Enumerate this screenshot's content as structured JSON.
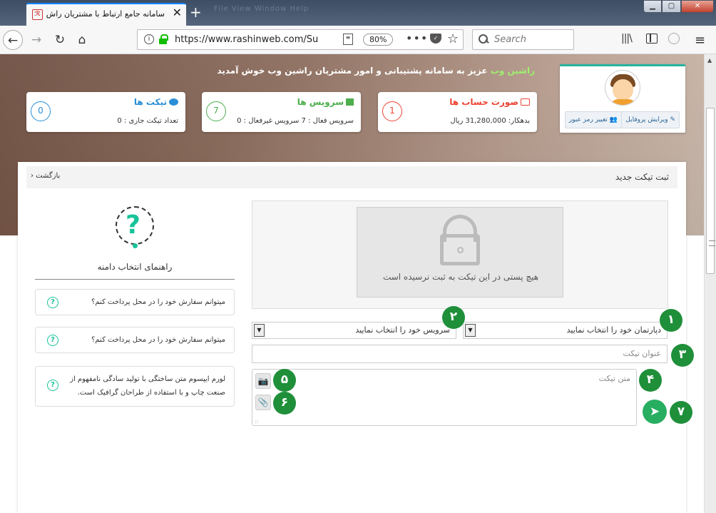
{
  "browser": {
    "tab_title": "سامانه جامع ارتباط با مشتریان راش",
    "tab_favicon": "ℛ",
    "new_tab": "+",
    "faint_menu": "File   View   Window   Help",
    "url": "https://www.rashinweb.com/Sup",
    "zoom": "80%",
    "search_placeholder": "Search",
    "icons": {
      "back": "back-arrow-icon",
      "forward": "forward-arrow-icon",
      "reload": "reload-icon",
      "home": "home-icon",
      "library": "library-icon",
      "sidebar": "sidebar-icon",
      "globe": "globe-icon",
      "menu": "hamburger-menu-icon"
    }
  },
  "hero": {
    "welcome_highlight": "راشین وب",
    "welcome_text": "عزیز به سامانه پشتیبانی و امور مشتریان راشین وب خوش آمدید",
    "profile": {
      "edit_profile": "ویرایش پروفایل",
      "change_password": "تغییر رمز عبور"
    },
    "cards": {
      "invoices": {
        "title": "صورت حساب ها",
        "count": "1",
        "info": "بدهکار: 31,280,000 ریال",
        "color": "#e44433"
      },
      "services": {
        "title": "سرویس ها",
        "count": "7",
        "info": "سرویس فعال : 7    سرویس غیرفعال : 0",
        "color": "#4cae4c"
      },
      "tickets": {
        "title": "تیکت ها",
        "count": "0",
        "info": "تعداد تیکت جاری : 0",
        "color": "#2a8fd6"
      }
    }
  },
  "page": {
    "title": "ثبت تیکت جدید",
    "back_link": "بازگشت ‹",
    "no_posts": "هیچ پستی در این تیکت به ثبت نرسیده است",
    "department_select": "دپارتمان خود را انتخاب نمایید",
    "service_select": "سرویس خود را انتخاب نمایید",
    "subject_placeholder": "عنوان تیکت",
    "message_placeholder": "متن تیکت"
  },
  "help": {
    "title": "راهنمای انتخاب دامنه",
    "question_mark": "?",
    "faqs": [
      "میتوانم سفارش خود را در محل پرداخت کنم؟",
      "میتوانم سفارش خود را در محل پرداخت کنم؟",
      "لورم ایپسوم متن ساختگی با تولید سادگی نامفهوم از صنعت چاپ و با استفاده از طراحان گرافیک است."
    ]
  },
  "annotations": [
    "۱",
    "۲",
    "۳",
    "۴",
    "۵",
    "۶",
    "۷"
  ],
  "accent_color": "#1f8f3a"
}
